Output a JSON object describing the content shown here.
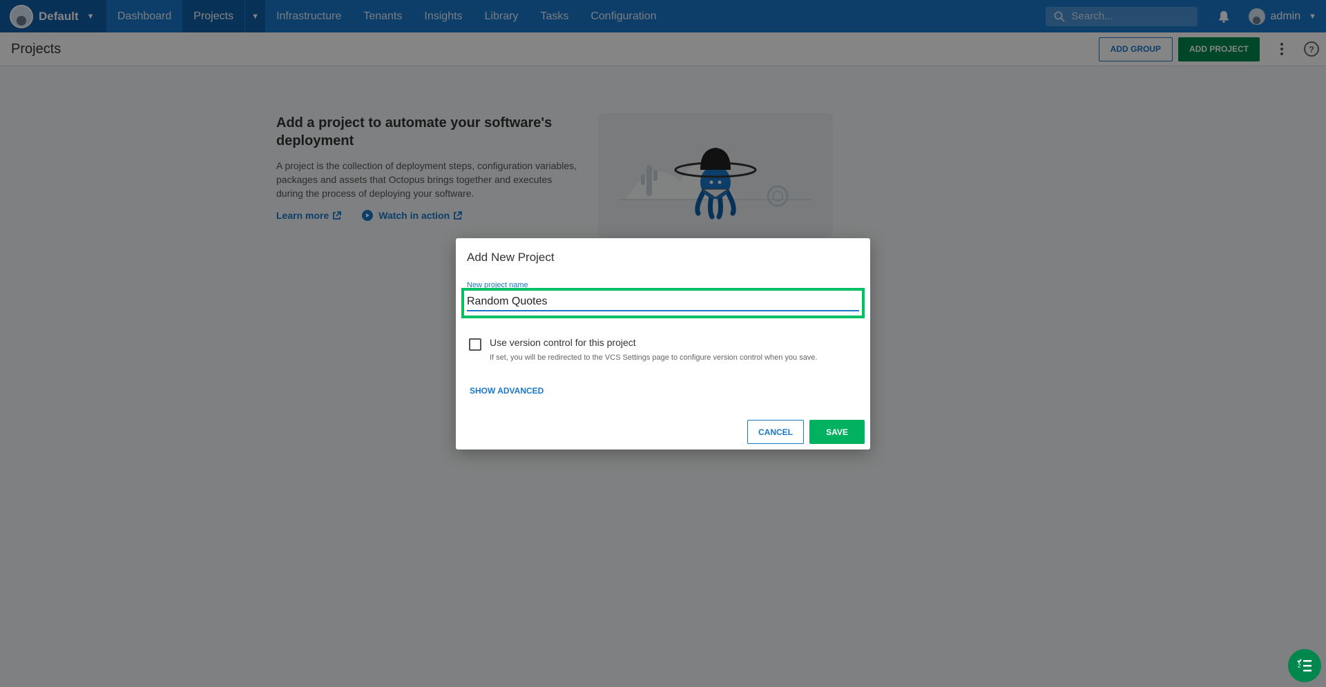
{
  "topnav": {
    "space_name": "Default",
    "items": [
      {
        "label": "Dashboard"
      },
      {
        "label": "Projects"
      },
      {
        "label": "Infrastructure"
      },
      {
        "label": "Tenants"
      },
      {
        "label": "Insights"
      },
      {
        "label": "Library"
      },
      {
        "label": "Tasks"
      },
      {
        "label": "Configuration"
      }
    ],
    "search_placeholder": "Search...",
    "user_name": "admin",
    "active_item": "Projects"
  },
  "page_header": {
    "title": "Projects",
    "add_group_label": "ADD GROUP",
    "add_project_label": "ADD PROJECT"
  },
  "onboarding": {
    "heading": "Add a project to automate your software's deployment",
    "description": "A project is the collection of deployment steps, configuration variables, packages and assets that Octopus brings together and executes during the process of deploying your software.",
    "learn_more": "Learn more",
    "watch_in_action": "Watch in action"
  },
  "dialog": {
    "title": "Add New Project",
    "name_label": "New project name",
    "name_value": "Random Quotes",
    "version_control_label": "Use version control for this project",
    "version_control_checked": false,
    "version_control_help": "If set, you will be redirected to the VCS Settings page to configure version control when you save.",
    "show_advanced": "SHOW ADVANCED",
    "cancel_label": "CANCEL",
    "save_label": "SAVE"
  },
  "colors": {
    "nav_blue": "#1a77ca",
    "nav_active": "#0f5fa6",
    "primary_green": "#00874d",
    "save_green": "#00b160",
    "highlight_green": "#00c064"
  },
  "icons": [
    "space-avatar-icon",
    "chevron-down-icon",
    "search-icon",
    "bell-icon",
    "user-avatar-icon",
    "kebab-menu-icon",
    "help-icon",
    "external-link-icon",
    "play-icon",
    "checklist-icon"
  ]
}
